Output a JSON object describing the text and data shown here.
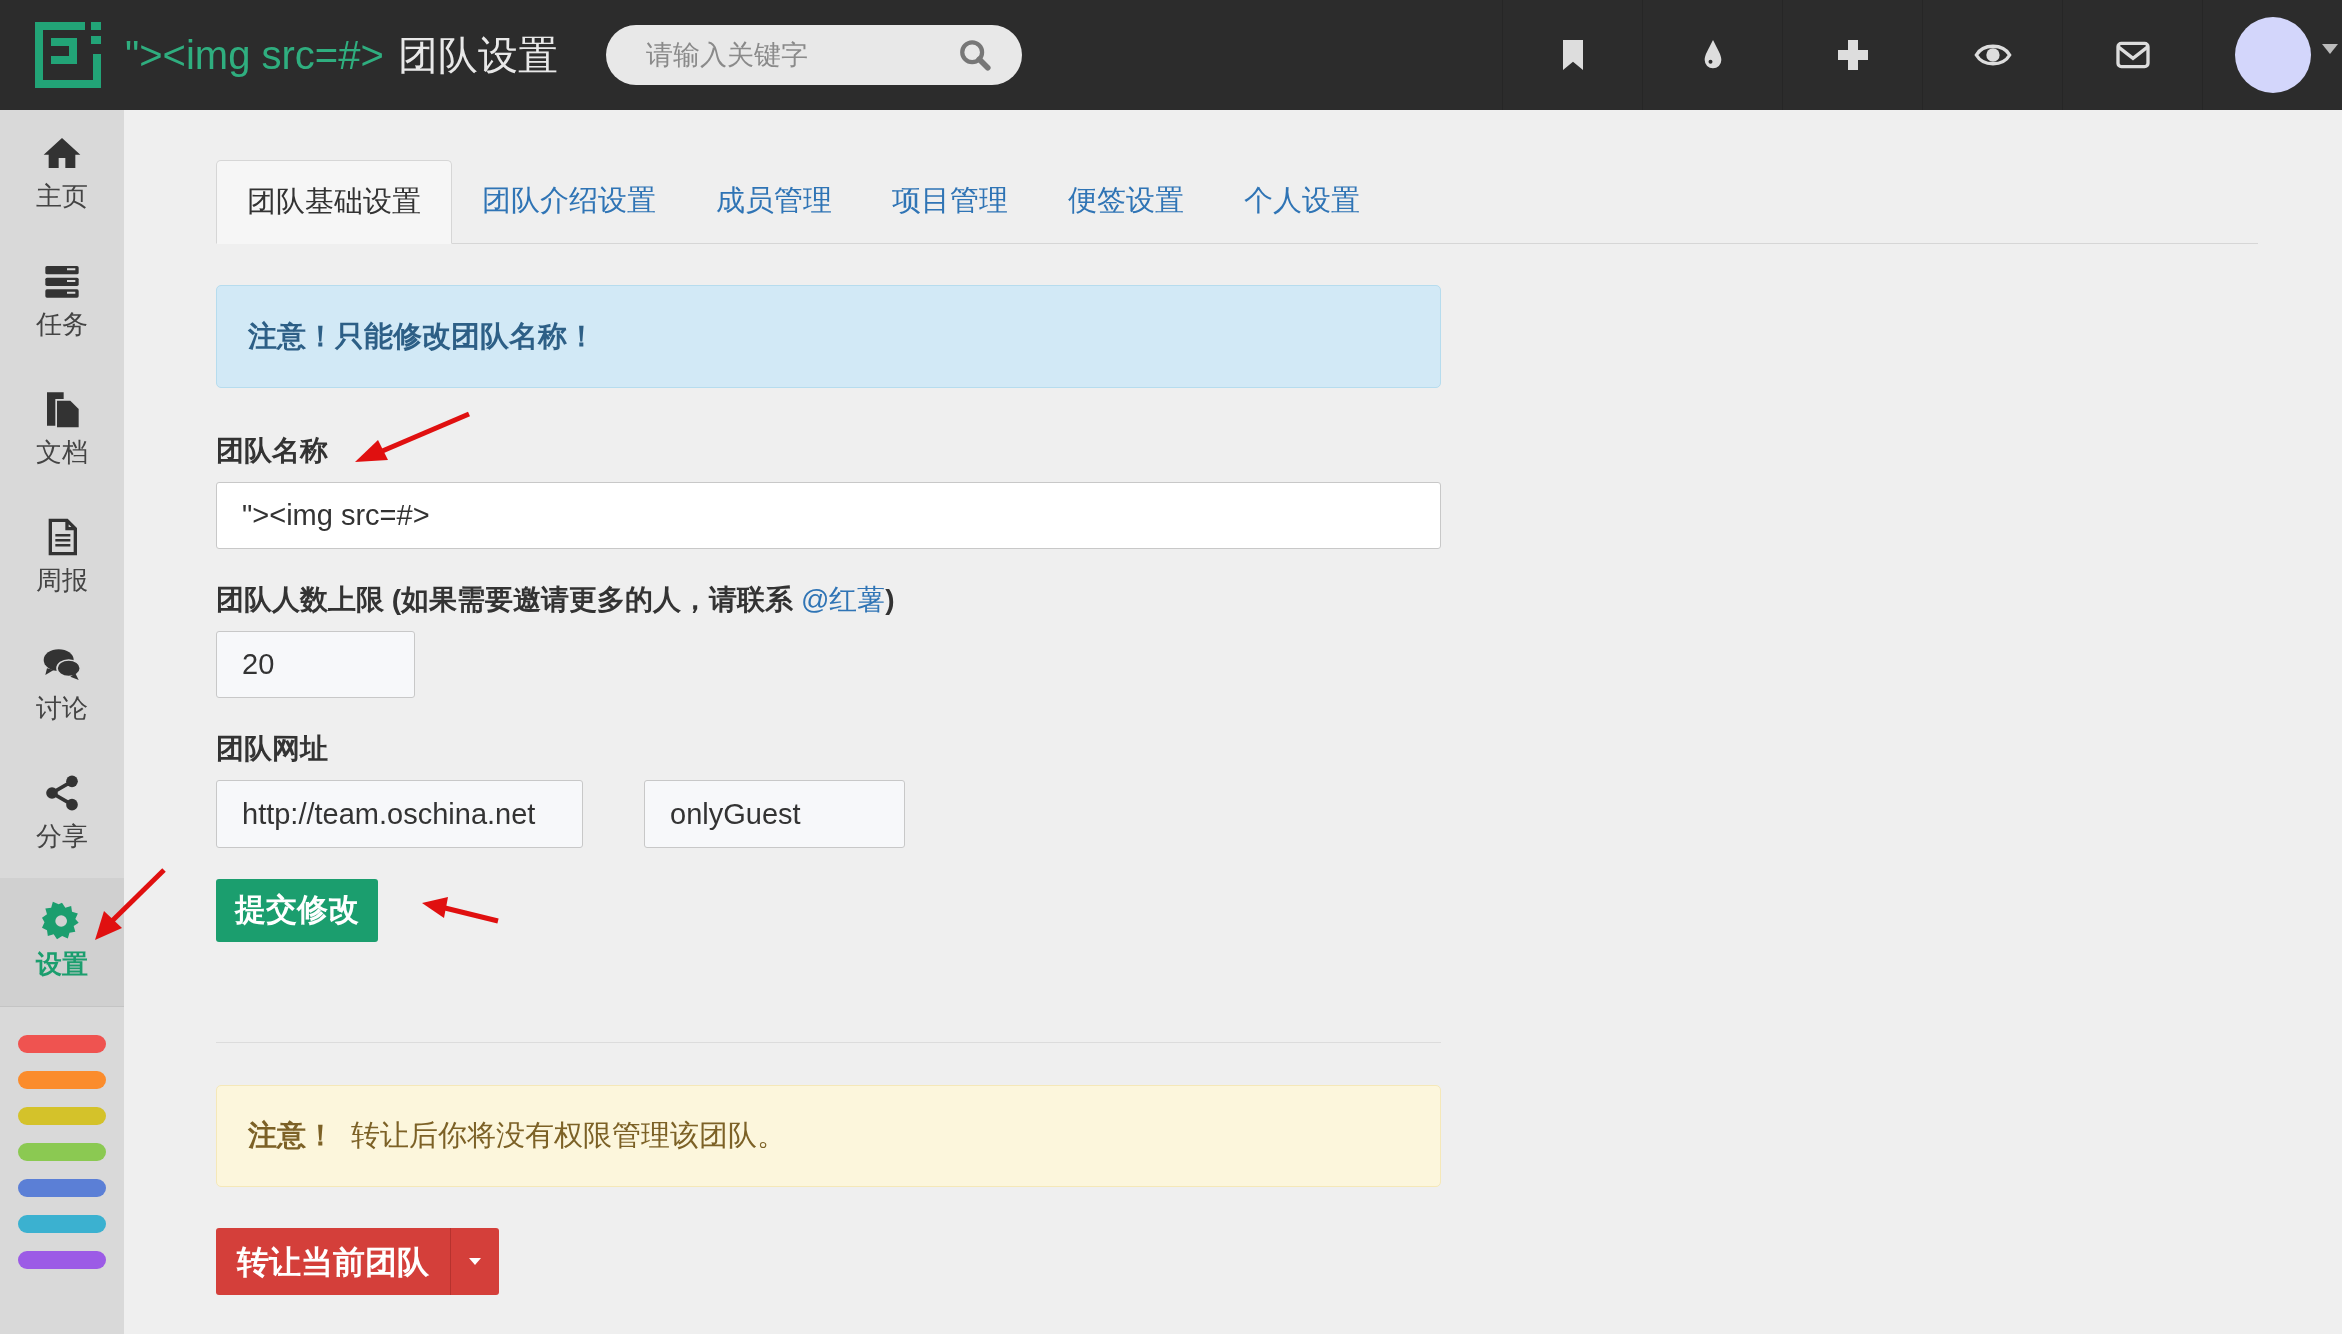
{
  "header": {
    "title_code": "\"><img src=#>",
    "title": "团队设置",
    "search": {
      "placeholder": "请输入关键字"
    },
    "icons": [
      {
        "kind": "bookmark"
      },
      {
        "kind": "drop"
      },
      {
        "kind": "plus"
      },
      {
        "kind": "eye"
      },
      {
        "kind": "mail"
      }
    ]
  },
  "sidebar": {
    "items": [
      {
        "kind": "home",
        "label": "主页",
        "selected": false
      },
      {
        "kind": "tasks",
        "label": "任务",
        "selected": false
      },
      {
        "kind": "docs",
        "label": "文档",
        "selected": false
      },
      {
        "kind": "report",
        "label": "周报",
        "selected": false
      },
      {
        "kind": "chat",
        "label": "讨论",
        "selected": false
      },
      {
        "kind": "share",
        "label": "分享",
        "selected": false
      },
      {
        "kind": "gear",
        "label": "设置",
        "selected": true
      }
    ],
    "color_tags": [
      {
        "color": "#ef5350"
      },
      {
        "color": "#fb8c2c"
      },
      {
        "color": "#d4c22a"
      },
      {
        "color": "#8bc952"
      },
      {
        "color": "#5b7fd6"
      },
      {
        "color": "#3bb1d0"
      },
      {
        "color": "#9c5be6"
      }
    ]
  },
  "tabs": [
    {
      "label": "团队基础设置",
      "selected": true
    },
    {
      "label": "团队介绍设置",
      "selected": false
    },
    {
      "label": "成员管理",
      "selected": false
    },
    {
      "label": "项目管理",
      "selected": false
    },
    {
      "label": "便签设置",
      "selected": false
    },
    {
      "label": "个人设置",
      "selected": false
    }
  ],
  "info_alert": "注意！只能修改团队名称！",
  "team_name": {
    "label": "团队名称",
    "value": "\"><img src=#>"
  },
  "member_limit": {
    "label": "团队人数上限 (如果需要邀请更多的人，请联系 ",
    "link": "@红薯",
    "label_end": ")",
    "value": "20"
  },
  "team_url": {
    "label": "团队网址",
    "prefix": "http://team.oschina.net",
    "value": "onlyGuest"
  },
  "submit_button": "提交修改",
  "warning_alert": {
    "strong": "注意！",
    "text": "转让后你将没有权限管理该团队。"
  },
  "transfer_button": "转让当前团队"
}
